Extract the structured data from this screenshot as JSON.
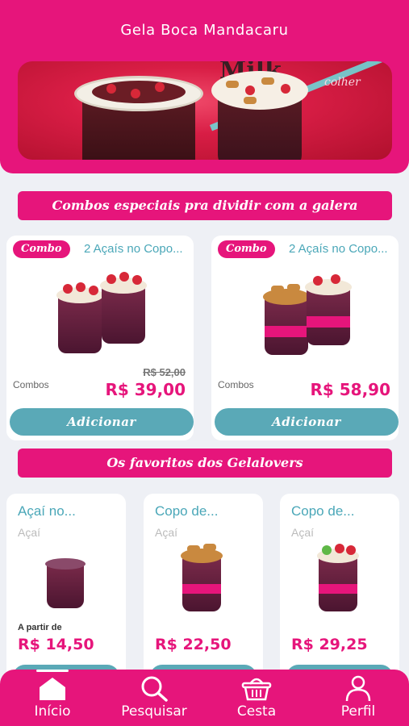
{
  "app": {
    "title": "Gela Boca Mandacaru"
  },
  "banner": {
    "word1": "Milk",
    "word2": "colher"
  },
  "sections": {
    "combos": "Combos especiais pra dividir com a galera",
    "favorites": "Os favoritos dos Gelalovers"
  },
  "combos": [
    {
      "badge": "Combo",
      "name": "2 Açaís no Copo...",
      "category": "Combos",
      "old_price": "R$ 52,00",
      "price": "R$ 39,00",
      "button": "Adicionar"
    },
    {
      "badge": "Combo",
      "name": "2 Açaís no Copo...",
      "category": "Combos",
      "old_price": "",
      "price": "R$ 58,90",
      "button": "Adicionar"
    }
  ],
  "favorites": [
    {
      "name": "Açaí no...",
      "category": "Açaí",
      "from_label": "A partir de",
      "price": "R$ 14,50"
    },
    {
      "name": "Copo de...",
      "category": "Açaí",
      "from_label": "",
      "price": "R$ 22,50"
    },
    {
      "name": "Copo de...",
      "category": "Açaí",
      "from_label": "",
      "price": "R$ 29,25"
    }
  ],
  "nav": [
    {
      "label": "Início",
      "icon": "home-icon",
      "active": true
    },
    {
      "label": "Pesquisar",
      "icon": "search-icon",
      "active": false
    },
    {
      "label": "Cesta",
      "icon": "basket-icon",
      "active": false
    },
    {
      "label": "Perfil",
      "icon": "user-icon",
      "active": false
    }
  ],
  "colors": {
    "brand": "#e6157b",
    "accent": "#5aa9b7",
    "name_text": "#4aa7b8",
    "background": "#eef0f5"
  }
}
